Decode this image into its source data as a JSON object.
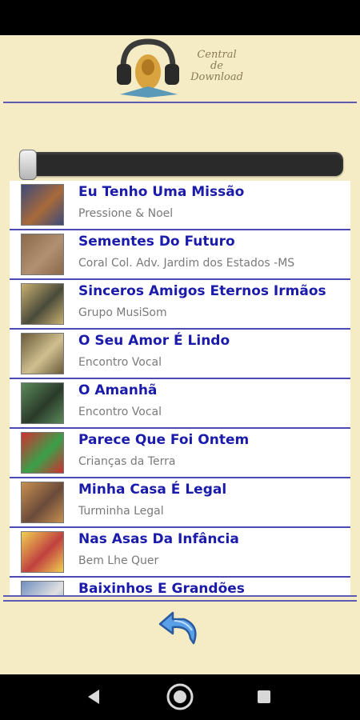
{
  "header": {
    "logo_text_line1": "Central",
    "logo_text_line2": "de",
    "logo_text_line3": "Download"
  },
  "player": {
    "progress": 0.0
  },
  "songs": [
    {
      "title": "Eu Tenho Uma Missão",
      "artist": "Pressione & Noel",
      "cover_colors": [
        "#3d4a7a",
        "#a86a3a"
      ]
    },
    {
      "title": "Sementes Do Futuro",
      "artist": "Coral Col. Adv. Jardim dos Estados -MS",
      "cover_colors": [
        "#8a6a4a",
        "#b09070"
      ]
    },
    {
      "title": "Sinceros Amigos Eternos Irmãos",
      "artist": "Grupo MusiSom",
      "cover_colors": [
        "#c8b070",
        "#4a4a3a"
      ]
    },
    {
      "title": "O Seu Amor É Lindo",
      "artist": "Encontro Vocal",
      "cover_colors": [
        "#6a5a3a",
        "#d0c090"
      ]
    },
    {
      "title": "O Amanhã",
      "artist": "Encontro Vocal",
      "cover_colors": [
        "#5a8a5a",
        "#2a3a2a"
      ]
    },
    {
      "title": "Parece Que Foi Ontem",
      "artist": "Crianças da Terra",
      "cover_colors": [
        "#d03030",
        "#3aa04a"
      ]
    },
    {
      "title": "Minha Casa É Legal",
      "artist": "Turminha Legal",
      "cover_colors": [
        "#c89050",
        "#6a4a3a"
      ]
    },
    {
      "title": "Nas Asas Da Infância",
      "artist": "Bem Lhe Quer",
      "cover_colors": [
        "#f0d050",
        "#c04040"
      ]
    },
    {
      "title": "Baixinhos E Grandões",
      "artist": "",
      "cover_colors": [
        "#7090c0",
        "#e0e0e0"
      ]
    }
  ],
  "colors": {
    "background": "#f5ebc4",
    "title_text": "#1b1bab",
    "artist_text": "#7a7a7a",
    "divider": "#5b5bb3"
  },
  "icons": {
    "back_button": "curved-back-arrow-icon",
    "nav_back": "triangle-back-icon",
    "nav_home": "circle-home-icon",
    "nav_recent": "square-recents-icon"
  }
}
